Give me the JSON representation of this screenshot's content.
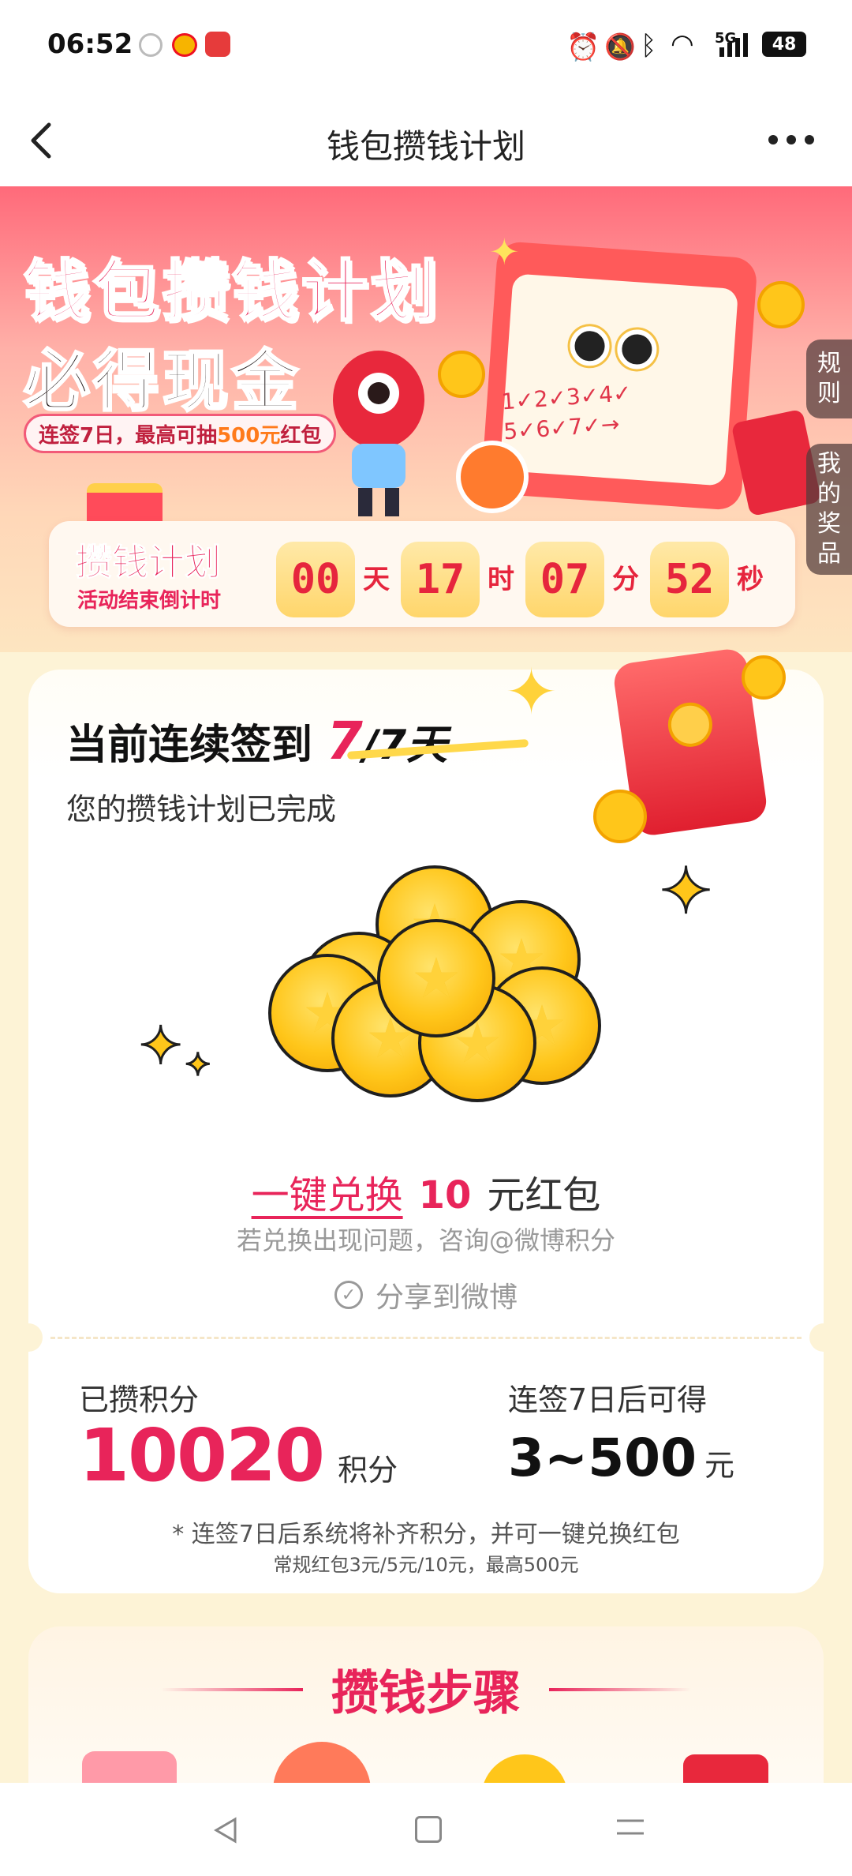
{
  "status": {
    "time": "06:52",
    "network": "5G",
    "battery": "48"
  },
  "nav": {
    "title": "钱包攒钱计划"
  },
  "banner": {
    "title_line1": "钱包攒钱计划",
    "title_line2": "必得现金",
    "subtitle_prefix": "连签7日，最高可抽",
    "subtitle_highlight": "500元",
    "subtitle_suffix": "红包",
    "side_rules": "规则",
    "side_prizes": "我的奖品",
    "calendar_text": "1✓2✓3✓4✓ 5✓6✓7✓→",
    "countdown": {
      "label_top": "攒钱计划",
      "label_bottom": "活动结束倒计时",
      "days": "00",
      "days_unit": "天",
      "hours": "17",
      "hours_unit": "时",
      "minutes": "07",
      "minutes_unit": "分",
      "seconds": "52",
      "seconds_unit": "秒"
    }
  },
  "checkin": {
    "title_prefix": "当前连续签到",
    "current": "7",
    "total": "/7天",
    "status": "您的攒钱计划已完成"
  },
  "redeem": {
    "link": "一键兑换",
    "amount": "10",
    "unit": "元红包",
    "help": "若兑换出现问题，咨询@微博积分",
    "share": "分享到微博"
  },
  "points": {
    "label": "已攒积分",
    "value": "10020",
    "unit": "积分",
    "reward_label": "连签7日后可得",
    "reward_value": "3~500",
    "reward_unit": "元",
    "note1": "* 连签7日后系统将补齐积分，并可一键兑换红包",
    "note2": "常规红包3元/5元/10元，最高500元"
  },
  "steps": {
    "title": "攒钱步骤"
  },
  "colors": {
    "accent": "#e8245a",
    "banner_top": "#ff6a7a",
    "background": "#fdf3d6",
    "coin": "#ffc61a"
  }
}
